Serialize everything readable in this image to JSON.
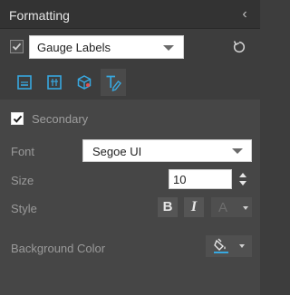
{
  "header": {
    "title": "Formatting",
    "collapse_icon": "chevron-left-icon"
  },
  "top": {
    "enabled": true,
    "element_select": "Gauge Labels",
    "reset_icon": "reset-icon"
  },
  "tabs": [
    {
      "icon": "label-bottom-icon",
      "active": false
    },
    {
      "icon": "label-center-icon",
      "active": false
    },
    {
      "icon": "cube-icon",
      "active": false
    },
    {
      "icon": "text-style-icon",
      "active": true
    }
  ],
  "panel": {
    "secondary": {
      "label": "Secondary",
      "checked": true
    },
    "font": {
      "label": "Font",
      "value": "Segoe UI"
    },
    "size": {
      "label": "Size",
      "value": "10"
    },
    "style": {
      "label": "Style",
      "bold": "B",
      "italic": "I",
      "color": "A"
    },
    "background": {
      "label": "Background Color",
      "icon": "paint-bucket-icon"
    }
  },
  "colors": {
    "accent": "#38a8e0",
    "background": "#3d3d3d",
    "panel": "#464646"
  }
}
